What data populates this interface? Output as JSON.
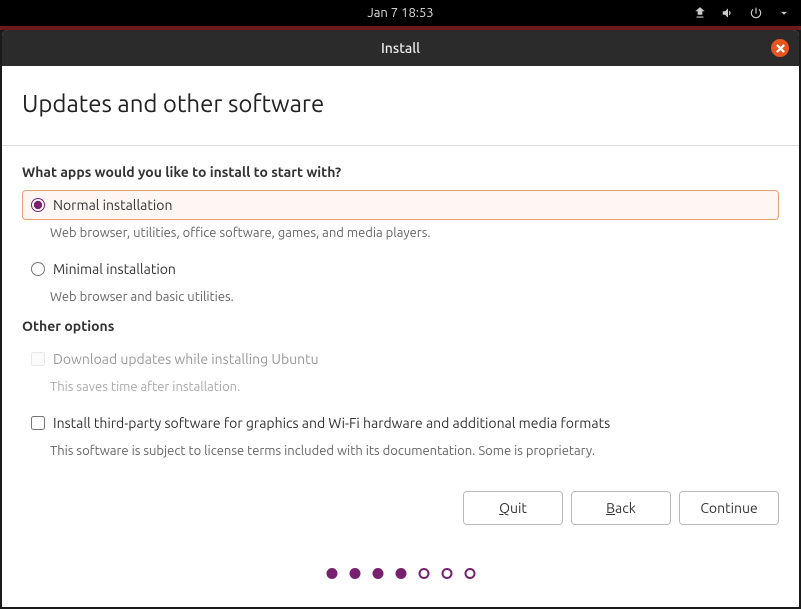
{
  "topbar": {
    "datetime": "Jan 7  18:53"
  },
  "window": {
    "title": "Install"
  },
  "page": {
    "title": "Updates and other software",
    "heading_apps": "What apps would you like to install to start with?",
    "normal": {
      "label": "Normal installation",
      "desc": "Web browser, utilities, office software, games, and media players."
    },
    "minimal": {
      "label": "Minimal installation",
      "desc": "Web browser and basic utilities."
    },
    "heading_other": "Other options",
    "download_updates": {
      "label": "Download updates while installing Ubuntu",
      "desc": "This saves time after installation."
    },
    "third_party": {
      "label": "Install third-party software for graphics and Wi-Fi hardware and additional media formats",
      "desc": "This software is subject to license terms included with its documentation. Some is proprietary."
    }
  },
  "buttons": {
    "quit": "uit",
    "quit_mnemonic": "Q",
    "back": "ack",
    "back_mnemonic": "B",
    "continue": "Continue"
  },
  "progress": {
    "current": 4,
    "total": 7
  }
}
